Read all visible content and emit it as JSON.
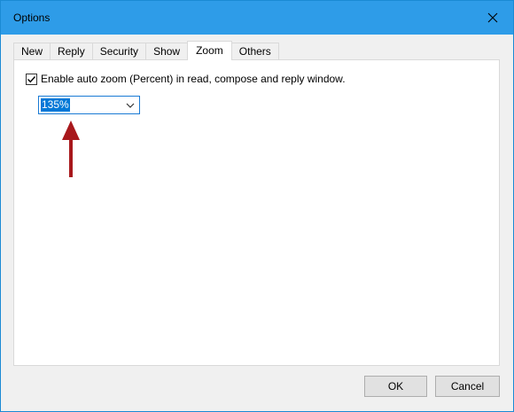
{
  "window": {
    "title": "Options"
  },
  "tabs": [
    {
      "label": "New"
    },
    {
      "label": "Reply"
    },
    {
      "label": "Security"
    },
    {
      "label": "Show"
    },
    {
      "label": "Zoom"
    },
    {
      "label": "Others"
    }
  ],
  "active_tab": "Zoom",
  "zoom": {
    "checkbox_label": "Enable auto zoom (Percent) in read, compose and reply window.",
    "checkbox_checked": true,
    "percent_value": "135%"
  },
  "buttons": {
    "ok_label": "OK",
    "cancel_label": "Cancel"
  },
  "colors": {
    "titlebar": "#2e9ce8",
    "selection": "#0078d7",
    "annotation_arrow": "#a8181c"
  },
  "icons": {
    "close": "close-icon",
    "dropdown": "chevron-down-icon",
    "checkbox": "checkmark-icon",
    "annotation": "arrow-up-icon"
  }
}
